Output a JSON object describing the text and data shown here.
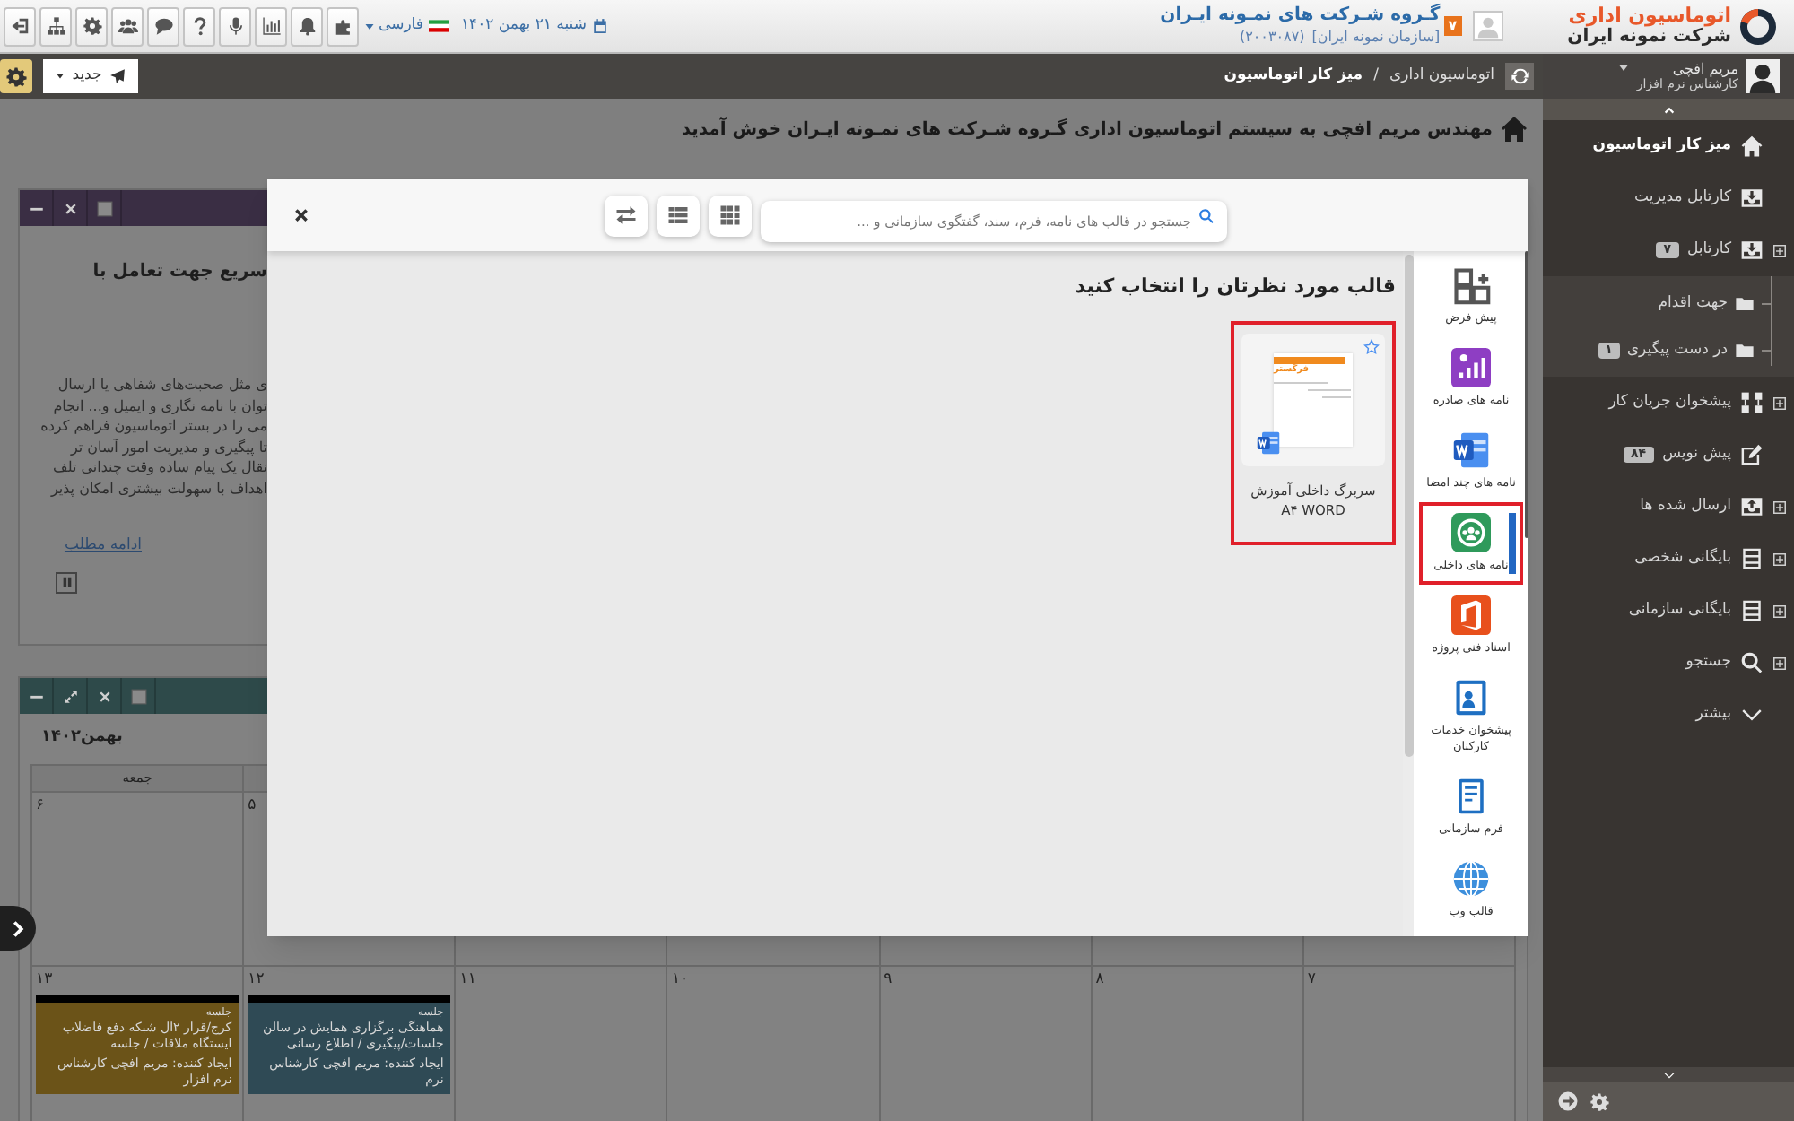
{
  "top_bar": {
    "logo": {
      "title": "اتوماسیون اداری",
      "subtitle": "شرکت نمونه ایران"
    },
    "organization": {
      "badge": "۷",
      "name": "گـروه شـرکت های نمـونه ایـران",
      "code": "(۲۰۰۳۰۸۷)",
      "unit": "[سازمان نمونه ایران]"
    },
    "date": "شنبه ۲۱ بهمن ۱۴۰۲",
    "language": "فارسی"
  },
  "user": {
    "name": "مریم افچی",
    "role": "کارشناس نرم افزار"
  },
  "toolbar": {
    "new_button": "جدید",
    "breadcrumb": [
      "اتوماسیون اداری",
      "میز کار اتوماسیون"
    ],
    "breadcrumb_separator": "/"
  },
  "sidebar": {
    "items": [
      {
        "label": "میز کار اتوماسیون",
        "selected": true,
        "expandable": false
      },
      {
        "label": "کارتابل مدیریت",
        "selected": false,
        "expandable": false
      },
      {
        "label": "کارتابل",
        "badge": "۷",
        "selected": false,
        "expandable": true,
        "expanded": true,
        "children": [
          {
            "label": "جهت اقدام",
            "selected": false
          },
          {
            "label": "در دست پیگیری",
            "badge": "۱",
            "selected": false
          }
        ]
      },
      {
        "label": "پیشخوان جریان کار",
        "selected": false,
        "expandable": true
      },
      {
        "label": "پیش نویس",
        "badge": "۸۴",
        "selected": false,
        "expandable": false
      },
      {
        "label": "ارسال شده ها",
        "selected": false,
        "expandable": true
      },
      {
        "label": "بایگانی شخصی",
        "selected": false,
        "expandable": true
      },
      {
        "label": "بایگانی سازمانی",
        "selected": false,
        "expandable": true
      },
      {
        "label": "جستجو",
        "selected": false,
        "expandable": true
      },
      {
        "label": "بیشتر",
        "selected": false,
        "expandable": false
      }
    ]
  },
  "welcome": "مهندس مریم افچی به سیستم اتوماسیون اداری گـروه شـرکت های نمـونه ایـران خوش آمدید",
  "info_widget": {
    "title": "سریع جهت تعامل با",
    "lines": [
      "ی مثل صحبت‌های شفاهی یا ارسال",
      "توان با نامه نگاری و ایمیل و... انجام",
      "می را در بستر اتوماسیون فراهم کرده",
      "تا پیگیری و مدیریت امور آسان تر",
      "نقال یک پیام ساده وقت چندانی تلف",
      "اهداف با سهولت بیشتری امکان پذیر"
    ],
    "link": "ادامه مطلب"
  },
  "calendar": {
    "month": "بهمن۱۴۰۲",
    "weekdays": [
      "جمعه"
    ],
    "weeks": [
      [
        {
          "day": "۵"
        },
        {
          "day": "۶"
        }
      ],
      [
        {
          "day": "۷"
        },
        {
          "day": "۸"
        },
        {
          "day": "۹"
        },
        {
          "day": "۱۰"
        },
        {
          "day": "۱۱"
        },
        {
          "day": "۱۲",
          "events": [
            {
              "type": "جلسه",
              "title": "هماهنگی برگزاری همایش در سالن جلسات/پیگیری / اطلاع رسانی",
              "creator": "ایجاد کننده: مریم افچی کارشناس نرم",
              "color": "#2f4a55"
            }
          ]
        },
        {
          "day": "۱۳",
          "events": [
            {
              "type": "جلسه",
              "title": "کرج/قرار ۲ال شبکه دفع فاضلاب ایستگاه ملاقات / جلسه",
              "creator": "ایجاد کننده: مریم افچی کارشناس نرم افزار",
              "color": "#6b5318"
            }
          ]
        }
      ]
    ]
  },
  "modal": {
    "search_placeholder": "جستجو در قالب های نامه، فرم، سند، گفتگوی سازمانی و ...",
    "title": "قالب مورد نظرتان را انتخاب کنید",
    "templates": [
      {
        "name": "سربرگ داخلی آموزش A۴ WORD",
        "preview_text": "فرگستر",
        "selected": true
      }
    ],
    "categories": [
      {
        "label": "پیش فرض",
        "selected": false
      },
      {
        "label": "نامه های صادره",
        "selected": false
      },
      {
        "label": "نامه های چند امضا",
        "selected": false
      },
      {
        "label": "نامه های داخلی",
        "selected": true
      },
      {
        "label": "اسناد فنی پروژه",
        "selected": false
      },
      {
        "label": "پیشخوان خدمات کارکنان",
        "selected": false
      },
      {
        "label": "فرم سازمانی",
        "selected": false
      },
      {
        "label": "قالب وب",
        "selected": false
      }
    ]
  }
}
